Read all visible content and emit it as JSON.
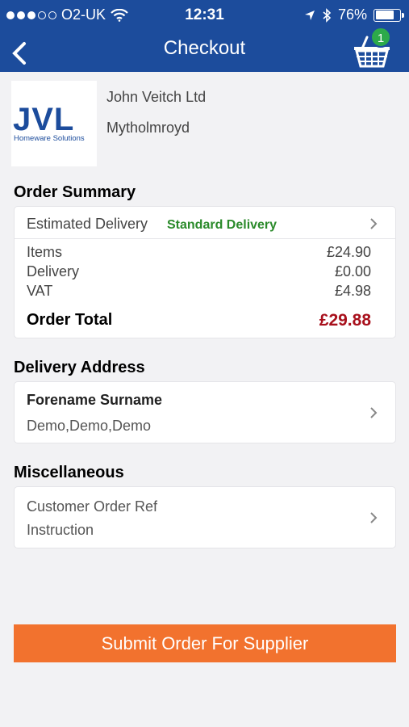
{
  "status_bar": {
    "carrier": "O2-UK",
    "time": "12:31",
    "battery": "76%",
    "battery_level": 0.76
  },
  "nav": {
    "title": "Checkout",
    "cart_count": "1"
  },
  "supplier": {
    "logo_text": "JVL",
    "logo_subtitle": "Homeware Solutions",
    "name": "John Veitch Ltd",
    "town": "Mytholmroyd"
  },
  "order_summary": {
    "heading": "Order Summary",
    "delivery_label": "Estimated Delivery",
    "delivery_value": "Standard Delivery",
    "items_label": "Items",
    "items_value": "£24.90",
    "delivery_cost_label": "Delivery",
    "delivery_cost_value": "£0.00",
    "vat_label": "VAT",
    "vat_value": "£4.98",
    "total_label": "Order Total",
    "total_value": "£29.88"
  },
  "delivery_address": {
    "heading": "Delivery Address",
    "name": "Forename Surname",
    "address": "Demo,Demo,Demo"
  },
  "misc": {
    "heading": "Miscellaneous",
    "order_ref": "Customer Order Ref",
    "instruction": "Instruction"
  },
  "submit_label": "Submit Order For Supplier",
  "colors": {
    "header": "#1c4c9c",
    "accent_orange": "#f2722e",
    "delivery_green": "#2a8a2a",
    "total_red": "#a8101c",
    "badge_green": "#2daa4a"
  }
}
